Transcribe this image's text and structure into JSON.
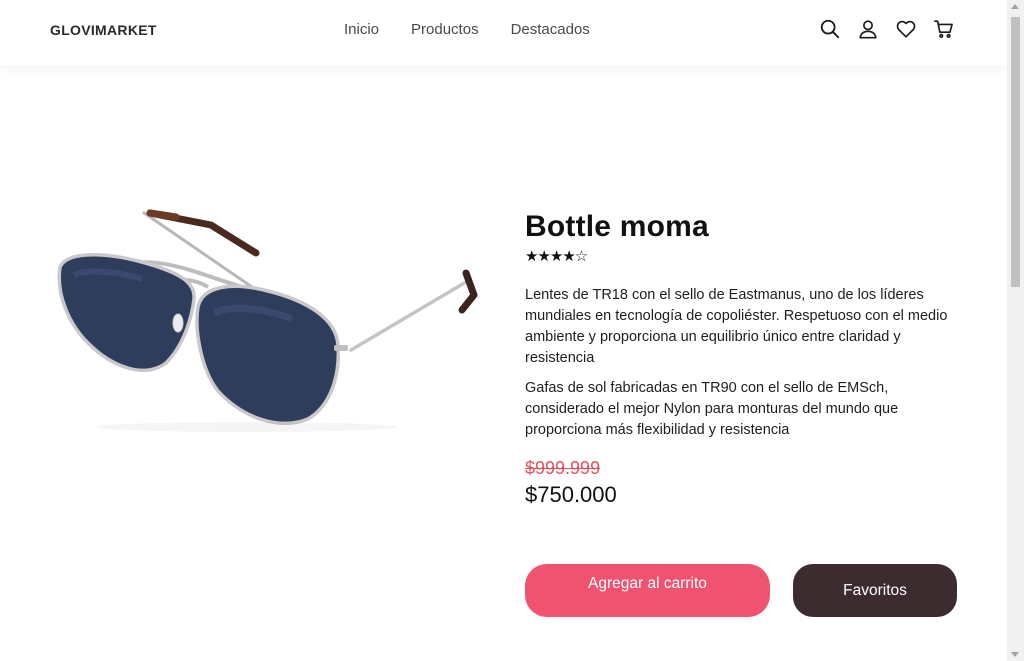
{
  "header": {
    "logo": "GLOVIMARKET",
    "nav": [
      "Inicio",
      "Productos",
      "Destacados"
    ],
    "icons": [
      "search-icon",
      "user-icon",
      "heart-icon",
      "cart-icon"
    ]
  },
  "product": {
    "title": "Bottle moma",
    "rating_stars": "★★★★☆",
    "rating_value": 4.5,
    "description_1": "Lentes de TR18 con el sello de Eastmanus, uno de los líderes mundiales en tecnología de copoliéster. Respetuoso con el medio ambiente y proporciona un equilibrio único entre claridad y resistencia",
    "description_2": "Gafas de sol fabricadas en TR90 con el sello de EMSch, considerado el mejor Nylon para monturas del mundo que proporciona más flexibilidad y resistencia",
    "old_price": "$999.999",
    "price": "$750.000",
    "add_to_cart_label": "Agregar al carrito",
    "favorites_label": "Favoritos"
  },
  "colors": {
    "accent": "#f05370",
    "dark_button": "#3d2c2f",
    "old_price": "#e05060"
  }
}
